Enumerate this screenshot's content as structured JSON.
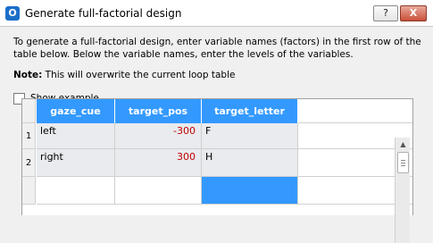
{
  "window": {
    "title": "Generate full-factorial design",
    "app_icon_glyph": "O",
    "help_label": "?",
    "close_label": "X"
  },
  "instructions": "To generate a full-factorial design, enter variable names (factors) in the first row of the table below. Below the variable names, enter the levels of the variables.",
  "note": {
    "label": "Note:",
    "text": " This will overwrite the current loop table"
  },
  "show_example": {
    "label": "Show example",
    "checked": false
  },
  "table": {
    "columns": [
      "gaze_cue",
      "target_pos",
      "target_letter"
    ],
    "rows": [
      {
        "num": "1",
        "cells": [
          "left",
          "-300",
          "F"
        ]
      },
      {
        "num": "2",
        "cells": [
          "right",
          "300",
          "H"
        ]
      }
    ]
  },
  "colors": {
    "header_bg": "#3399ff",
    "negative_number": "#c00000",
    "selected_cell": "#3399ff"
  }
}
